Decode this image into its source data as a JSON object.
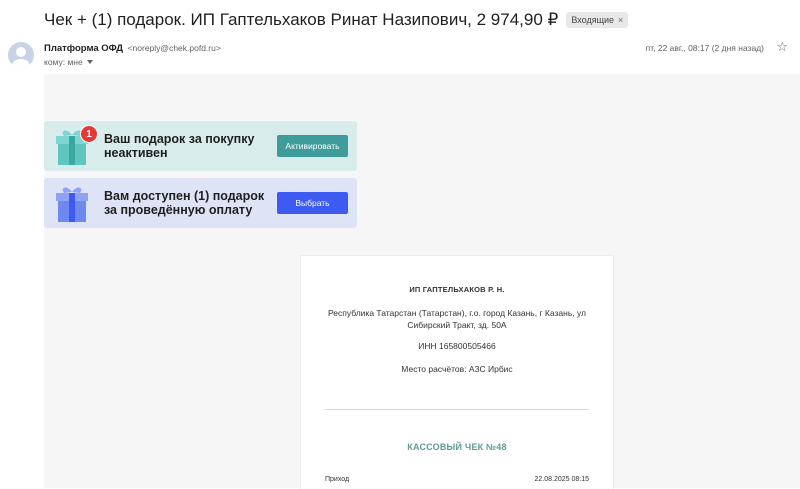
{
  "email": {
    "subject": "Чек + (1) подарок. ИП Гаптельхаков Ринат Назипович, 2 974,90 ₽",
    "label": "Входящие",
    "label_close": "×",
    "sender_name": "Платформа ОФД",
    "sender_email": "<noreply@chek.pofd.ru>",
    "recipient": "кому: мне",
    "date": "пт, 22 авг., 08:17 (2 дня назад)"
  },
  "promos": [
    {
      "text": "Ваш подарок за покупку неактивен",
      "button": "Активировать",
      "badge": "1"
    },
    {
      "text": "Вам доступен (1) подарок за проведённую оплату",
      "button": "Выбрать"
    }
  ],
  "receipt": {
    "company": "ИП ГАПТЕЛЬХАКОВ Р. Н.",
    "address": "Республика Татарстан (Татарстан), г.о. город Казань, г Казань, ул Сибирский Тракт, зд. 50А",
    "inn": "ИНН 165800505466",
    "place": "Место расчётов: АЗС Ирбис",
    "title": "КАССОВЫЙ ЧЕК №48",
    "type_label": "Приход",
    "datetime": "22.08.2025 08:15"
  },
  "colors": {
    "promo_teal": "#3e9c9a",
    "promo_blue": "#3d5af1",
    "receipt_title": "#5e9a99"
  },
  "icons": {
    "avatar": "person-avatar-icon",
    "star": "star-icon",
    "gift": "gift-box-icon"
  }
}
